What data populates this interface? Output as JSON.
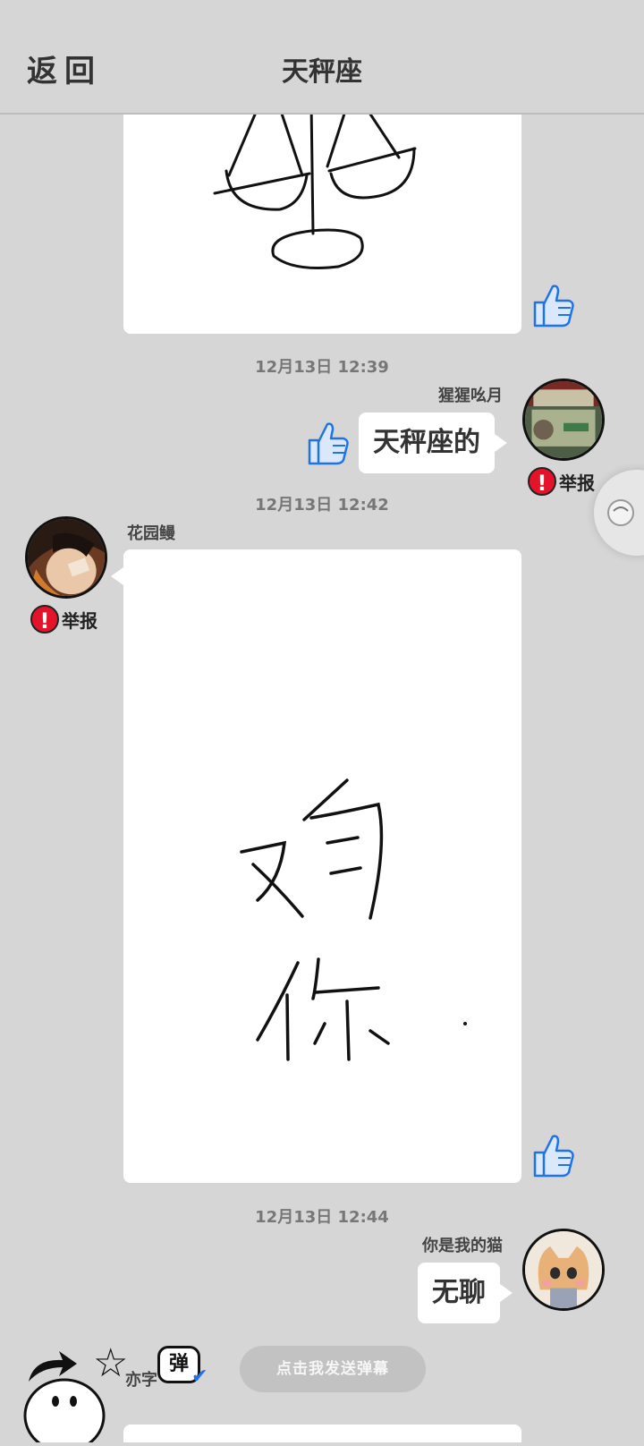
{
  "header": {
    "back_label": "返回",
    "title": "天秤座"
  },
  "messages": [
    {
      "type": "drawing",
      "side": "left",
      "content": "balance-scale-drawing"
    },
    {
      "timestamp": "12月13日  12:39",
      "username": "猩猩吆月",
      "side": "right",
      "text": "天秤座的",
      "report_label": "举报"
    },
    {
      "timestamp": "12月13日  12:42",
      "username": "花园鳗",
      "side": "left",
      "type": "drawing",
      "content": "handwritten-text-drawing",
      "report_label": "举报"
    },
    {
      "timestamp": "12月13日  12:44",
      "username": "你是我的猫",
      "side": "right",
      "text": "无聊"
    }
  ],
  "bottom_bar": {
    "danmu_placeholder": "点击我发送弹幕",
    "danmu_toggle_label": "弹",
    "partial_name": "亦字"
  },
  "colors": {
    "background": "#d6d6d6",
    "report_red": "#e3132a",
    "thumb_blue": "#1e73e8"
  },
  "icons": [
    "like-thumb-icon",
    "report-icon",
    "star-icon",
    "danmu-toggle-icon",
    "check-icon",
    "share-arrow-icon"
  ]
}
